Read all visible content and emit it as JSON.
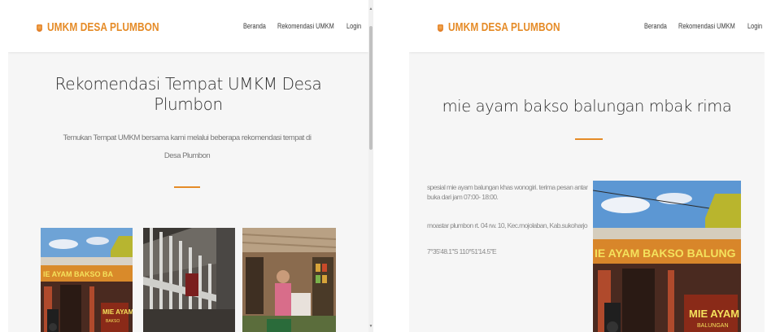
{
  "left_window": {
    "brand": "UMKM DESA PLUMBON",
    "nav": [
      "Beranda",
      "Rekomendasi UMKM",
      "Login"
    ],
    "title_line1": "Rekomendasi Tempat UMKM Desa",
    "title_line2": "Plumbon",
    "subtitle_line1": "Temukan Tempat UMKM bersama kami melalui beberapa rekomendasi tempat di",
    "subtitle_line2": "Desa Plumbon",
    "cards": [
      {
        "image_text": "MIE AYAM",
        "image_subtext": "BAKSO"
      },
      {
        "image_text": ""
      },
      {
        "image_text": ""
      }
    ]
  },
  "right_window": {
    "brand": "UMKM DESA PLUMBON",
    "nav": [
      "Beranda",
      "Rekomendasi UMKM",
      "Login"
    ],
    "title": "mie ayam bakso balungan mbak rima",
    "description": "spesial mie ayam balungan khas wonogiri. terima pesan antar buka dari jam 07:00- 18:00.",
    "address": "moastar plumbon rt. 04 rw. 10, Kec.mojolaban, Kab.sukoharjo",
    "coordinates": "7°35'48.1\"S 110°51'14.5\"E",
    "sign_banner": "IE AYAM BAKSO BALUNG",
    "sign_cart": "MIE AYAM",
    "sign_cart_sub": "BALUNGAN"
  },
  "colors": {
    "accent": "#e58b27",
    "hero_bg": "#f6f6f6"
  }
}
